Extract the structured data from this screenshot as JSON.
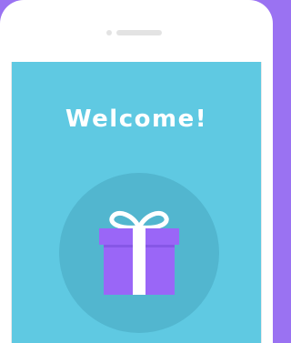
{
  "screen": {
    "title": "Welcome!"
  },
  "colors": {
    "frame_accent": "#9a72f2",
    "screen_bg": "#5fc9e2",
    "circle_bg": "#52b6cf",
    "gift_box": "#9a66f7",
    "ribbon": "#ffffff"
  },
  "icons": {
    "hero": "gift-icon"
  }
}
